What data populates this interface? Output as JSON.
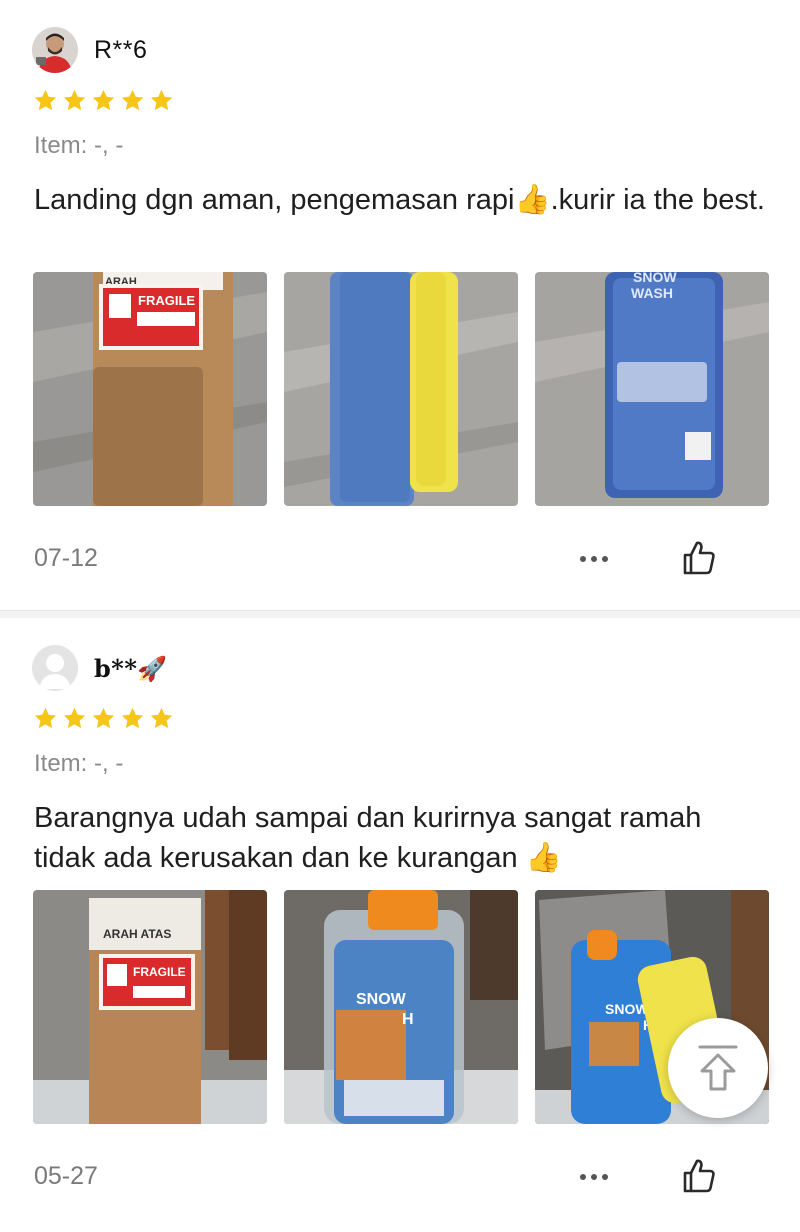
{
  "reviews": [
    {
      "username": "R**6",
      "rating": 5,
      "item": "Item: -, -",
      "text": "Landing dgn aman, pengemasan rapi👍.kurir ia the best.",
      "date": "07-12",
      "photo_labels": [
        "ARAH",
        "FRAGILE",
        "SNOW",
        "WASH"
      ]
    },
    {
      "username": "b**🚀",
      "rating": 5,
      "item": "Item: -, -",
      "text": "Barangnya udah sampai dan kurirnya sangat ramah tidak ada kerusakan dan ke kurangan 👍",
      "date": "05-27",
      "photo_labels": [
        "ARAH ATAS",
        "FRAGILE",
        "SNOW",
        "H",
        "SNOW",
        "H"
      ]
    }
  ],
  "icons": {
    "star": "star-icon",
    "more": "more-icon",
    "like": "thumbs-up-icon",
    "scroll_top": "scroll-to-top-icon"
  },
  "colors": {
    "star": "#f5c518",
    "text": "#1f1f1f",
    "muted": "#8a8a8a"
  }
}
